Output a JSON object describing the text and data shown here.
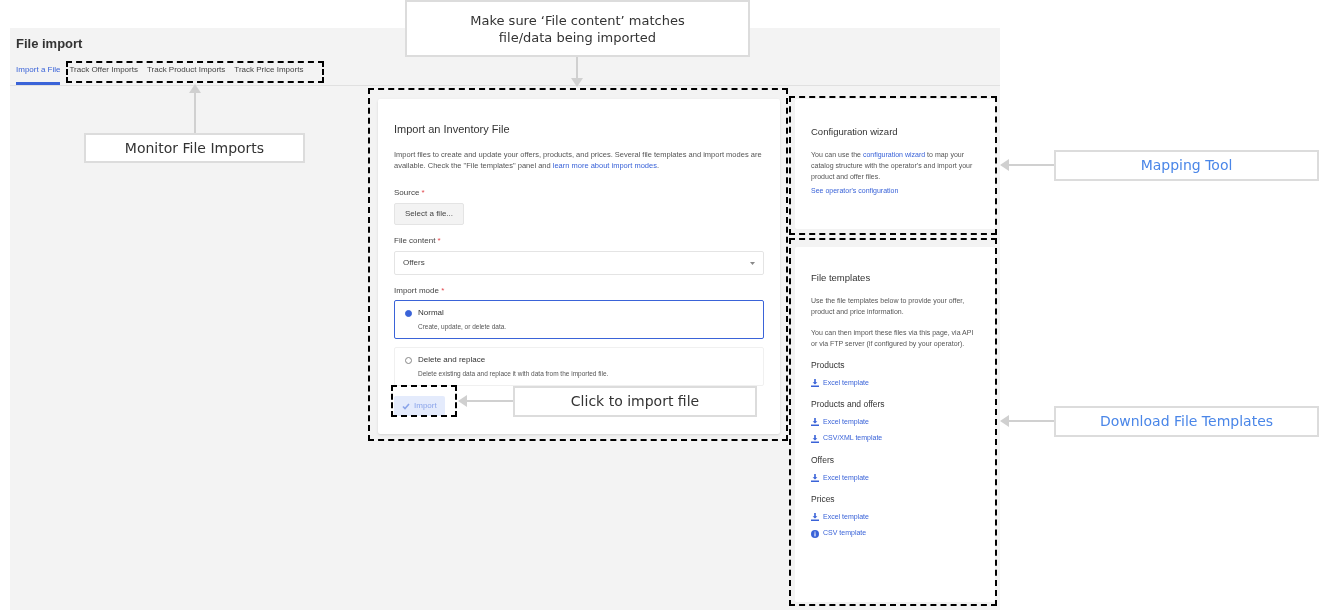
{
  "page": {
    "title": "File import"
  },
  "tabs": [
    {
      "label": "Import a File",
      "selected": true
    },
    {
      "label": "Track Offer Imports",
      "selected": false
    },
    {
      "label": "Track Product Imports",
      "selected": false
    },
    {
      "label": "Track Price Imports",
      "selected": false
    }
  ],
  "import_card": {
    "title": "Import an Inventory File",
    "description": "Import files to create and update your offers, products, and prices. Several file templates and import modes are available. Check the \"File templates\" panel and ",
    "description_link": "learn more about import modes",
    "description_end": ".",
    "source": {
      "label": "Source",
      "required_mark": "*",
      "button": "Select a file..."
    },
    "file_content": {
      "label": "File content",
      "required_mark": "*",
      "value": "Offers"
    },
    "import_mode": {
      "label": "Import mode",
      "required_mark": "*",
      "options": [
        {
          "title": "Normal",
          "description": "Create, update, or delete data.",
          "selected": true
        },
        {
          "title": "Delete and replace",
          "description": "Delete existing data and replace it with data from the imported file.",
          "selected": false
        }
      ]
    },
    "import_button": {
      "label": "Import",
      "disabled": true
    }
  },
  "config_card": {
    "title": "Configuration wizard",
    "text_before": "You can use the ",
    "link": "configuration wizard",
    "text_after": " to map your catalog structure with the operator's and import your product and offer files.",
    "footer_link": "See operator's configuration"
  },
  "templates_card": {
    "title": "File templates",
    "paragraphs": [
      "Use the file templates below to provide your offer, product and price information.",
      "You can then import these files via this page, via API or via FTP server (if configured by your operator)."
    ],
    "sections": [
      {
        "title": "Products",
        "links": [
          {
            "label": "Excel template",
            "kind": "download"
          }
        ]
      },
      {
        "title": "Products and offers",
        "links": [
          {
            "label": "Excel template",
            "kind": "download"
          },
          {
            "label": "CSV/XML template",
            "kind": "download"
          }
        ]
      },
      {
        "title": "Offers",
        "links": [
          {
            "label": "Excel template",
            "kind": "download"
          }
        ]
      },
      {
        "title": "Prices",
        "links": [
          {
            "label": "Excel template",
            "kind": "download"
          },
          {
            "label": "CSV template",
            "kind": "info"
          }
        ]
      }
    ]
  },
  "callouts": [
    {
      "text": "Make sure ‘File content’ matches file/data being imported",
      "color": "#333333"
    },
    {
      "text": "Monitor File Imports",
      "color": "#333333"
    },
    {
      "text": "Click to import file",
      "color": "#333333"
    },
    {
      "text": "Mapping Tool",
      "color": "#4a86e8"
    },
    {
      "text": "Download File Templates",
      "color": "#4a86e8"
    }
  ]
}
